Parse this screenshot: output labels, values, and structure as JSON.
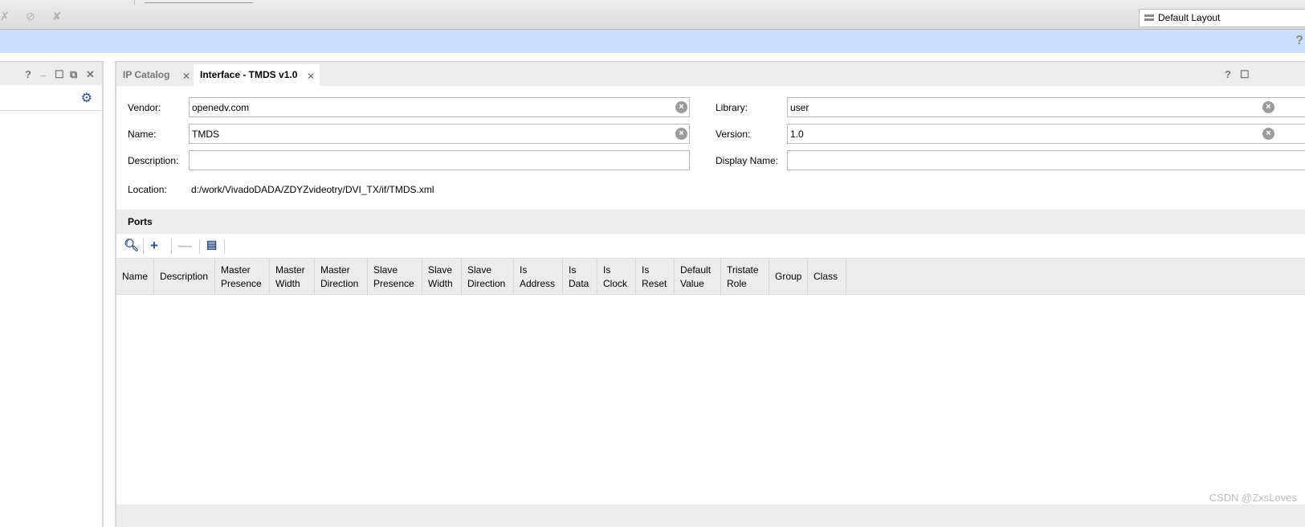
{
  "toolbar": {
    "layout_select": "Default Layout",
    "help": "?"
  },
  "left_panel": {
    "buttons": [
      "?",
      "_",
      "☐",
      "⧉",
      "✕"
    ]
  },
  "tabs": [
    {
      "label": "IP Catalog",
      "active": false
    },
    {
      "label": "Interface - TMDS v1.0",
      "active": true
    }
  ],
  "tab_controls": [
    "?",
    "☐"
  ],
  "form": {
    "vendor_label": "Vendor:",
    "vendor": "openedv.com",
    "name_label": "Name:",
    "name": "TMDS",
    "description_label": "Description:",
    "description": "",
    "location_label": "Location:",
    "location": "d:/work/VivadoDADA/ZDYZvideotry/DVI_TX/if/TMDS.xml",
    "library_label": "Library:",
    "library": "user",
    "version_label": "Version:",
    "version": "1.0",
    "display_name_label": "Display Name:",
    "display_name": ""
  },
  "ports": {
    "title": "Ports",
    "columns": [
      "Name",
      "Description",
      "Master\nPresence",
      "Master\nWidth",
      "Master\nDirection",
      "Slave\nPresence",
      "Slave\nWidth",
      "Slave\nDirection",
      "Is\nAddress",
      "Is\nData",
      "Is\nClock",
      "Is\nReset",
      "Default\nValue",
      "Tristate\nRole",
      "Group",
      "Class"
    ],
    "rows": []
  },
  "watermark": "CSDN @ZxsLoves",
  "colors": {
    "accent_band": "#cadffb",
    "icon_blue": "#2f4f80"
  }
}
